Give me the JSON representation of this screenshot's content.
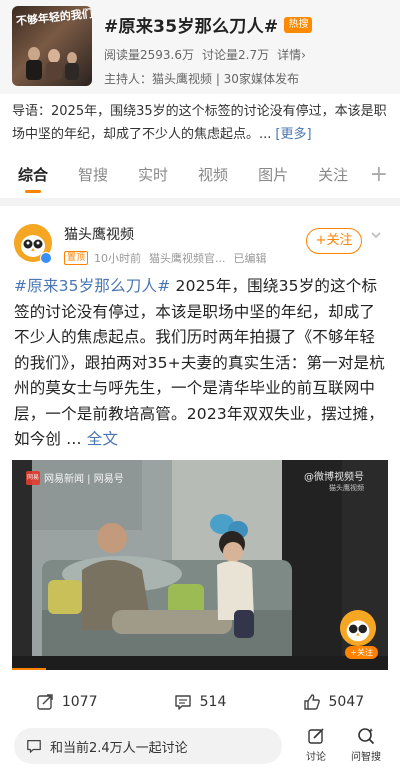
{
  "topic": {
    "title": "#原来35岁那么刀人#",
    "hot_badge": "热搜",
    "cover_title": "不够年轻的我们",
    "read_count": "阅读量2593.6万",
    "discussion_count": "讨论量2.7万",
    "details_label": "详情›",
    "host": "主持人：猫头鹰视频 | 30家媒体发布"
  },
  "intro": {
    "text": "导语：2025年，围绕35岁的这个标签的讨论没有停过，本该是职场中坚的年纪，却成了不少人的焦虑起点。...",
    "more_label": "[更多]"
  },
  "tabs": {
    "items": [
      {
        "label": "综合",
        "active": true
      },
      {
        "label": "智搜",
        "active": false
      },
      {
        "label": "实时",
        "active": false
      },
      {
        "label": "视频",
        "active": false
      },
      {
        "label": "图片",
        "active": false
      },
      {
        "label": "关注",
        "active": false
      }
    ],
    "add_label": "+"
  },
  "post": {
    "author": "猫头鹰视频",
    "top_badge": "置顶",
    "time": "10小时前",
    "source": "猫头鹰视频官...",
    "edited": "已编辑",
    "follow_label": "+关注",
    "hashtag": "#原来35岁那么刀人#",
    "body": " 2025年，围绕35岁的这个标签的讨论没有停过，本该是职场中坚的年纪，却成了不少人的焦虑起点。我们历时两年拍摄了《不够年轻的我们》，跟拍两对35+夫妻的真实生活：第一对是杭州的莫女士与呼先生，一个是清华毕业的前互联网中层，一个是前教培高管。2023年双双失业，摆过摊，如今创 ... ",
    "full_text_label": "全文"
  },
  "video": {
    "watermark_left_brand": "网易",
    "watermark_left": "网易新闻 | 网易号",
    "watermark_right": "@微博视频号",
    "watermark_right_sub": "猫头鹰视频",
    "follow_label": "+关注",
    "progress": 0.09
  },
  "actions": {
    "reposts": "1077",
    "comments": "514",
    "likes": "5047"
  },
  "bottom": {
    "discuss_placeholder": "和当前2.4万人一起讨论",
    "discuss_label": "讨论",
    "ask_label": "问智搜"
  },
  "colors": {
    "accent": "#ff8200",
    "link": "#4a76b3",
    "hot_badge": "#ff8a00",
    "verified": "#3a8ef6"
  },
  "icons": {
    "repost": "repost-icon",
    "comment": "comment-icon",
    "like": "thumbs-up-icon",
    "discuss": "chat-icon",
    "edit": "edit-icon",
    "ask": "ai-search-icon",
    "dropdown": "chevron-down-icon"
  }
}
